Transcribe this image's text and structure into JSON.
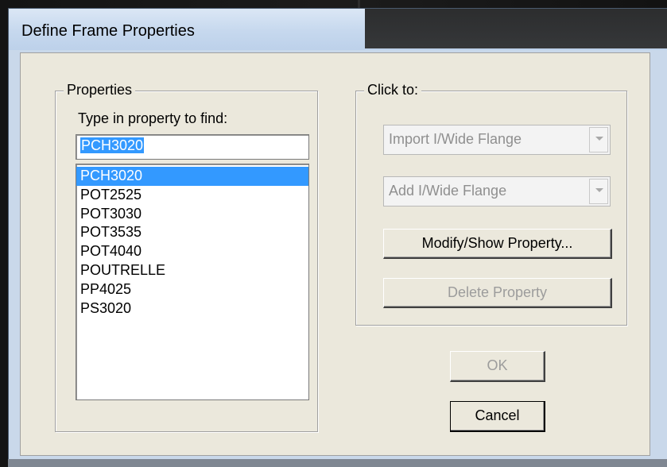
{
  "window": {
    "title": "Define Frame Properties"
  },
  "properties": {
    "group_label": "Properties",
    "find_label": "Type in property to find:",
    "find_value": "PCH3020",
    "items": [
      "PCH3020",
      "POT2525",
      "POT3030",
      "POT3535",
      "POT4040",
      "POUTRELLE",
      "PP4025",
      "PS3020"
    ],
    "selected_index": 0
  },
  "click_to": {
    "group_label": "Click to:",
    "import_combo": "Import I/Wide Flange",
    "add_combo": "Add I/Wide Flange",
    "modify_button": "Modify/Show Property...",
    "delete_button": "Delete Property"
  },
  "dialog_buttons": {
    "ok": "OK",
    "cancel": "Cancel"
  },
  "colors": {
    "selection": "#3399ff",
    "dialog_face": "#ebe8dc",
    "title_bar": "#c6d8ee"
  }
}
